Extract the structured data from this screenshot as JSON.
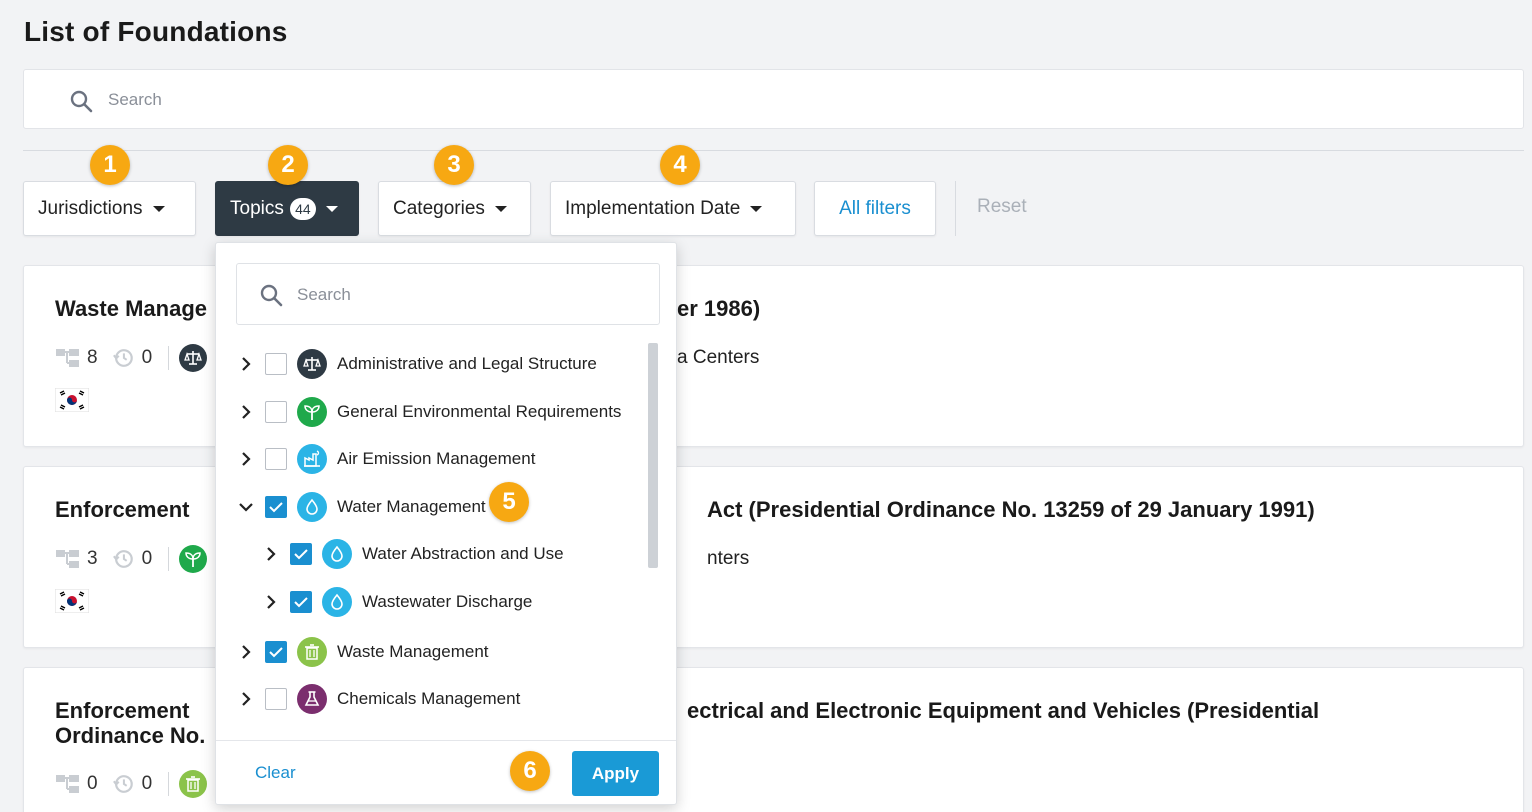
{
  "page": {
    "title": "List of Foundations"
  },
  "search": {
    "placeholder": "Search"
  },
  "filters": {
    "jurisdictions": "Jurisdictions",
    "topics": "Topics",
    "topics_count": "44",
    "categories": "Categories",
    "implementation_date": "Implementation Date",
    "all_filters": "All filters",
    "reset": "Reset"
  },
  "markers": [
    "1",
    "2",
    "3",
    "4",
    "5",
    "6"
  ],
  "cards": [
    {
      "title_left": "Waste Manage",
      "title_right": "er 1986)",
      "children_count": "8",
      "history_count": "0",
      "subtitle_right": "a Centers",
      "topic_icon": "scales-icon"
    },
    {
      "title_left": "Enforcement",
      "title_right": "Act (Presidential Ordinance No. 13259 of 29 January 1991)",
      "children_count": "3",
      "history_count": "0",
      "subtitle_right": "nters",
      "topic_icon": "sprout-icon"
    },
    {
      "title_left": "Enforcement",
      "title_left_line2": "Ordinance No.",
      "title_right": "ectrical and Electronic Equipment and Vehicles (Presidential",
      "children_count": "0",
      "history_count": "0",
      "topic_icon": "trash-icon"
    }
  ],
  "topics_dropdown": {
    "search_placeholder": "Search",
    "items": [
      {
        "label": "Administrative and Legal Structure",
        "checked": false,
        "expanded": false,
        "icon": "scales-icon",
        "color": "#2e3a44"
      },
      {
        "label": "General Environmental Requirements",
        "checked": false,
        "expanded": false,
        "icon": "sprout-icon",
        "color": "#1fa94b"
      },
      {
        "label": "Air Emission Management",
        "checked": false,
        "expanded": false,
        "icon": "factory-icon",
        "color": "#2bb4e6"
      },
      {
        "label": "Water Management",
        "checked": true,
        "expanded": true,
        "icon": "water-drop-icon",
        "color": "#2bb4e6"
      },
      {
        "label": "Water Abstraction and Use",
        "checked": true,
        "expanded": false,
        "icon": "water-drop-icon",
        "color": "#2bb4e6"
      },
      {
        "label": "Wastewater Discharge",
        "checked": true,
        "expanded": false,
        "icon": "water-drop-icon",
        "color": "#2bb4e6"
      },
      {
        "label": "Waste Management",
        "checked": true,
        "expanded": false,
        "icon": "trash-icon",
        "color": "#8bc34a"
      },
      {
        "label": "Chemicals Management",
        "checked": false,
        "expanded": false,
        "icon": "flask-icon",
        "color": "#7b2e6e"
      }
    ],
    "clear_label": "Clear",
    "apply_label": "Apply"
  },
  "colors": {
    "accent": "#1a8fd0",
    "marker": "#f7a812",
    "active_filter": "#2e3a44"
  }
}
